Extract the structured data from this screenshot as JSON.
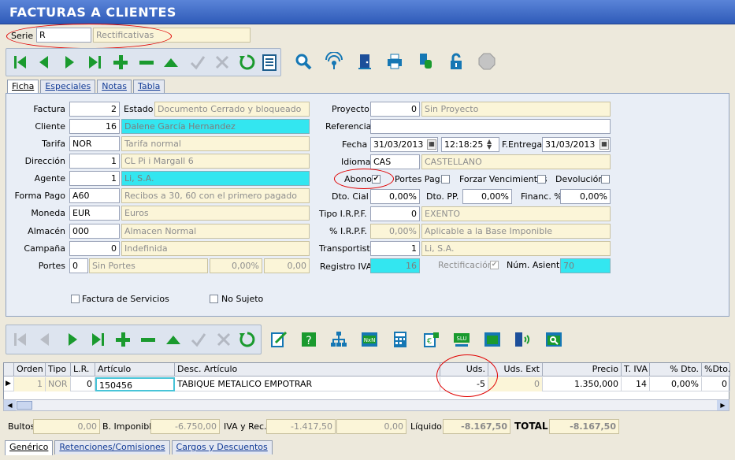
{
  "window_title": "FACTURAS A CLIENTES",
  "serie": {
    "label": "Serie",
    "code": "R",
    "name": "Rectificativas"
  },
  "tabs": [
    "Ficha",
    "Especiales",
    "Notas",
    "Tabla"
  ],
  "left": {
    "factura": {
      "label": "Factura",
      "value": "2"
    },
    "estado": {
      "label": "Estado",
      "value": "Documento Cerrado y bloqueado"
    },
    "cliente": {
      "label": "Cliente",
      "value": "16",
      "name": "Dalene García Hernandez"
    },
    "tarifa": {
      "label": "Tarifa",
      "code": "NOR",
      "name": "Tarifa normal"
    },
    "direccion": {
      "label": "Dirección",
      "value": "1",
      "name": "CL  Pi i Margall 6"
    },
    "agente": {
      "label": "Agente",
      "value": "1",
      "name": "Li, S.A."
    },
    "forma_pago": {
      "label": "Forma Pago",
      "code": "A60",
      "name": "Recibos a 30, 60 con el primero pagado"
    },
    "moneda": {
      "label": "Moneda",
      "code": "EUR",
      "name": "Euros"
    },
    "almacen": {
      "label": "Almacén",
      "code": "000",
      "name": "Almacen Normal"
    },
    "campana": {
      "label": "Campaña",
      "value": "0",
      "name": "Indefinida"
    },
    "portes": {
      "label": "Portes",
      "code": "0",
      "name": "Sin Portes",
      "pct": "0,00%",
      "amount": "0,00"
    }
  },
  "right": {
    "proyecto": {
      "label": "Proyecto",
      "value": "0",
      "name": "Sin Proyecto"
    },
    "referencia": {
      "label": "Referencia",
      "value": ""
    },
    "fecha": {
      "label": "Fecha",
      "date": "31/03/2013",
      "time": "12:18:25"
    },
    "f_entrega": {
      "label": "F.Entrega",
      "date": "31/03/2013"
    },
    "idioma": {
      "label": "Idioma",
      "code": "CAS",
      "name": "CASTELLANO"
    },
    "abono": {
      "label": "Abono",
      "checked": true
    },
    "portes_pag": {
      "label": "Portes Pag.",
      "checked": false
    },
    "forzar_venc": {
      "label": "Forzar Vencimientos",
      "checked": false
    },
    "devolucion": {
      "label": "Devolución",
      "checked": false
    },
    "dto_cial": {
      "label": "Dto. Cial",
      "value": "0,00%"
    },
    "dto_pp": {
      "label": "Dto. PP.",
      "value": "0,00%"
    },
    "financ": {
      "label": "Financ. %",
      "value": "0,00%"
    },
    "tipo_irpf": {
      "label": "Tipo I.R.P.F.",
      "value": "0",
      "name": "EXENTO"
    },
    "pct_irpf": {
      "label": "% I.R.P.F.",
      "value": "0,00%",
      "name": "Aplicable a la Base Imponible"
    },
    "transportista": {
      "label": "Transportista",
      "value": "1",
      "name": "Li, S.A."
    },
    "registro_iva": {
      "label": "Registro IVA",
      "value": "16"
    },
    "rectificacion": {
      "label": "Rectificación",
      "checked": true
    },
    "num_asiento": {
      "label": "Núm. Asiento",
      "value": "70"
    }
  },
  "bottom_checks": {
    "factura_servicios": "Factura de Servicios",
    "no_sujeto": "No Sujeto"
  },
  "grid": {
    "columns": [
      "Orden",
      "Tipo",
      "L.R.",
      "Artículo",
      "Desc. Artículo",
      "Uds.",
      "Uds. Ext",
      "Precio",
      "T. IVA",
      "% Dto.",
      "%Dto.2"
    ],
    "row": [
      "1",
      "NOR",
      "0",
      "150456",
      "TABIQUE METALICO EMPOTRAR",
      "-5",
      "0",
      "1.350,000",
      "14",
      "0,00%",
      "0"
    ]
  },
  "totals": {
    "bultos_label": "Bultos",
    "bultos": "0,00",
    "base_label": "B. Imponible",
    "base": "-6.750,00",
    "iva_label": "IVA y Rec.",
    "iva": "-1.417,50",
    "rec": "0,00",
    "liquido_label": "Líquido",
    "liquido": "-8.167,50",
    "total_label": "TOTAL",
    "total": "-8.167,50"
  },
  "bottom_tabs": [
    "Genérico",
    "Retenciones/Comisiones",
    "Cargos y Descuentos"
  ],
  "colors": {
    "title_bar": "#3a66c4",
    "cyan_field": "#33e6f0",
    "readonly_field": "#fbf5d8",
    "annotation": "#e00000"
  }
}
